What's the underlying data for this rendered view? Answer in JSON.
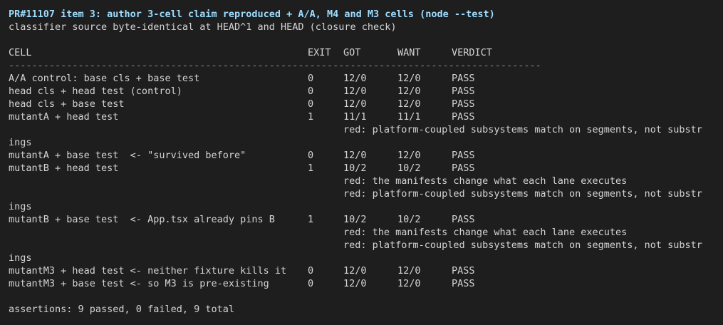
{
  "title": "PR#11107 item 3: author 3-cell claim reproduced + A/A, M4 and M3 cells (node --test)",
  "subtitle": "classifier source byte-identical at HEAD^1 and HEAD (closure check)",
  "headers": {
    "cell": "CELL",
    "exit": "EXIT",
    "got": "GOT",
    "want": "WANT",
    "verdict": "VERDICT"
  },
  "separator": "--------------------------------------------------------------------------------------------",
  "rows": [
    {
      "cell": "A/A control: base cls + base test",
      "exit": "0",
      "got": "12/0",
      "want": "12/0",
      "verdict": "PASS"
    },
    {
      "cell": "head cls + head test (control)",
      "exit": "0",
      "got": "12/0",
      "want": "12/0",
      "verdict": "PASS"
    },
    {
      "cell": "head cls + base test",
      "exit": "0",
      "got": "12/0",
      "want": "12/0",
      "verdict": "PASS"
    },
    {
      "cell": "mutantA + head test",
      "exit": "1",
      "got": "11/1",
      "want": "11/1",
      "verdict": "PASS"
    },
    {
      "cell": "mutantA + base test  <- \"survived before\"",
      "exit": "0",
      "got": "12/0",
      "want": "12/0",
      "verdict": "PASS"
    },
    {
      "cell": "mutantB + head test",
      "exit": "1",
      "got": "10/2",
      "want": "10/2",
      "verdict": "PASS"
    },
    {
      "cell": "mutantB + base test  <- App.tsx already pins B",
      "exit": "1",
      "got": "10/2",
      "want": "10/2",
      "verdict": "PASS"
    },
    {
      "cell": "mutantM3 + head test <- neither fixture kills it",
      "exit": "0",
      "got": "12/0",
      "want": "12/0",
      "verdict": "PASS"
    },
    {
      "cell": "mutantM3 + base test <- so M3 is pre-existing",
      "exit": "0",
      "got": "12/0",
      "want": "12/0",
      "verdict": "PASS"
    }
  ],
  "notes": {
    "platform_coupled": "red: platform-coupled subsystems match on segments, not substr",
    "platform_coupled_wrap": "ings",
    "manifests": "red: the manifests change what each lane executes"
  },
  "summary": "assertions: 9 passed, 0 failed, 9 total"
}
